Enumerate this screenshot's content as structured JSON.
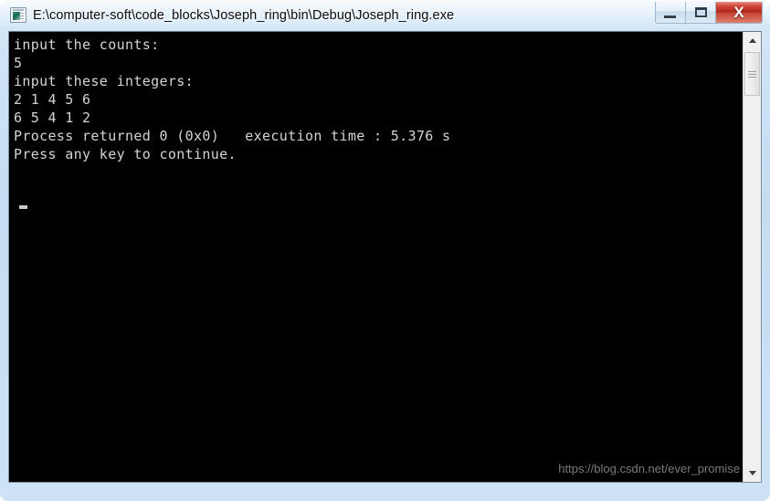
{
  "window": {
    "title": "E:\\computer-soft\\code_blocks\\Joseph_ring\\bin\\Debug\\Joseph_ring.exe",
    "icon": "console-app-icon",
    "controls": {
      "minimize_label": "—",
      "maximize_label": "□",
      "close_label": "X"
    },
    "frame_color": "#c5dcf2",
    "titlebar_text_color": "#0b0b0b"
  },
  "console": {
    "background_color": "#000000",
    "text_color": "#d4d4d4",
    "lines": [
      "input the counts:",
      "5",
      "input these integers:",
      "2 1 4 5 6",
      "6 5 4 1 2",
      "Process returned 0 (0x0)   execution time : 5.376 s",
      "Press any key to continue."
    ],
    "output": "input the counts:\n5\ninput these integers:\n2 1 4 5 6\n6 5 4 1 2\nProcess returned 0 (0x0)   execution time : 5.376 s\nPress any key to continue.",
    "cursor": "block-cursor"
  },
  "watermark": {
    "text": "https://blog.csdn.net/ever_promise",
    "color": "#7b7b7b"
  },
  "scrollbar": {
    "up_arrow": "scroll-up-arrow",
    "down_arrow": "scroll-down-arrow",
    "thumb": "scroll-thumb"
  }
}
